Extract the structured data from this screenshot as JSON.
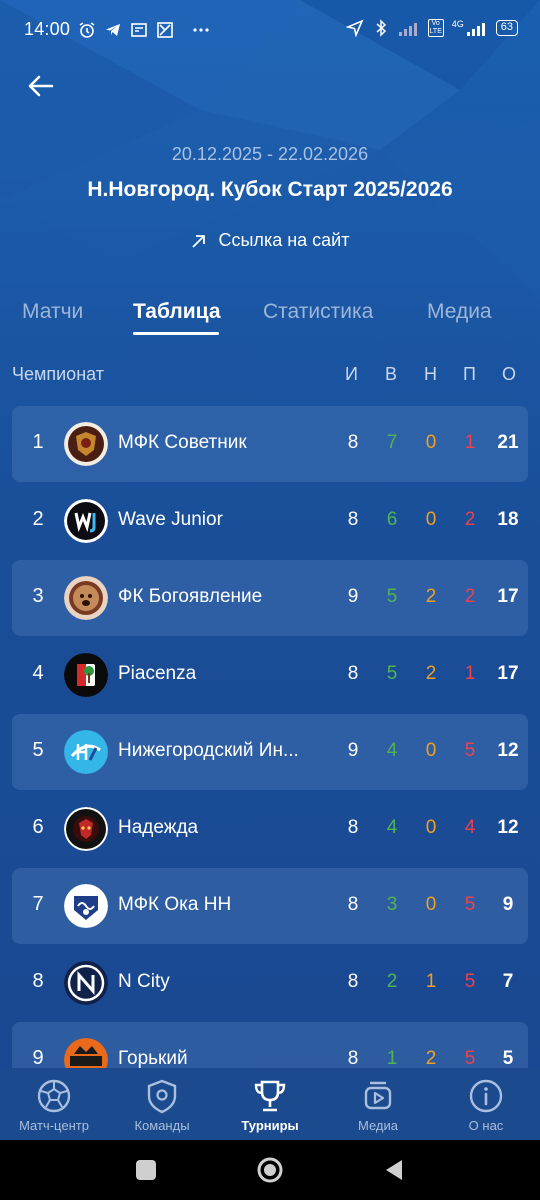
{
  "status_bar": {
    "time": "14:00",
    "battery": "63",
    "network": "4G",
    "volte": "Vo LTE"
  },
  "header": {
    "dates": "20.12.2025 - 22.02.2026",
    "title": "Н.Новгород. Кубок Старт 2025/2026",
    "site_link": "Ссылка на сайт"
  },
  "tabs": [
    {
      "label": "Матчи",
      "active": false
    },
    {
      "label": "Таблица",
      "active": true
    },
    {
      "label": "Статистика",
      "active": false
    },
    {
      "label": "Медиа",
      "active": false
    }
  ],
  "table": {
    "section_title": "Чемпионат",
    "columns": [
      "И",
      "В",
      "Н",
      "П",
      "О"
    ],
    "rows": [
      {
        "rank": "1",
        "team": "МФК Советник",
        "logo": "sovetnik-logo",
        "played": "8",
        "won": "7",
        "drawn": "0",
        "lost": "1",
        "points": "21"
      },
      {
        "rank": "2",
        "team": "Wave Junior",
        "logo": "wave-junior-logo",
        "played": "8",
        "won": "6",
        "drawn": "0",
        "lost": "2",
        "points": "18"
      },
      {
        "rank": "3",
        "team": "ФК Богоявление",
        "logo": "bogoyavlenie-logo",
        "played": "9",
        "won": "5",
        "drawn": "2",
        "lost": "2",
        "points": "17"
      },
      {
        "rank": "4",
        "team": "Piacenza",
        "logo": "piacenza-logo",
        "played": "8",
        "won": "5",
        "drawn": "2",
        "lost": "1",
        "points": "17"
      },
      {
        "rank": "5",
        "team": "Нижегородский Ин...",
        "logo": "nizhegorodsky-logo",
        "played": "9",
        "won": "4",
        "drawn": "0",
        "lost": "5",
        "points": "12"
      },
      {
        "rank": "6",
        "team": "Надежда",
        "logo": "nadezhda-logo",
        "played": "8",
        "won": "4",
        "drawn": "0",
        "lost": "4",
        "points": "12"
      },
      {
        "rank": "7",
        "team": "МФК Ока НН",
        "logo": "oka-logo",
        "played": "8",
        "won": "3",
        "drawn": "0",
        "lost": "5",
        "points": "9"
      },
      {
        "rank": "8",
        "team": "N City",
        "logo": "n-city-logo",
        "played": "8",
        "won": "2",
        "drawn": "1",
        "lost": "5",
        "points": "7"
      },
      {
        "rank": "9",
        "team": "Горький",
        "logo": "gorky-logo",
        "played": "8",
        "won": "1",
        "drawn": "2",
        "lost": "5",
        "points": "5"
      }
    ]
  },
  "bottom_nav": [
    {
      "label": "Матч-центр",
      "icon": "soccer-ball-icon",
      "active": false
    },
    {
      "label": "Команды",
      "icon": "shield-icon",
      "active": false
    },
    {
      "label": "Турниры",
      "icon": "trophy-icon",
      "active": true
    },
    {
      "label": "Медиа",
      "icon": "media-play-icon",
      "active": false
    },
    {
      "label": "О нас",
      "icon": "info-icon",
      "active": false
    }
  ],
  "colors": {
    "background": "#1a5aa8",
    "won": "#52b352",
    "drawn": "#f0a020",
    "lost": "#f0404a",
    "row_shade": "#4a74b0"
  }
}
